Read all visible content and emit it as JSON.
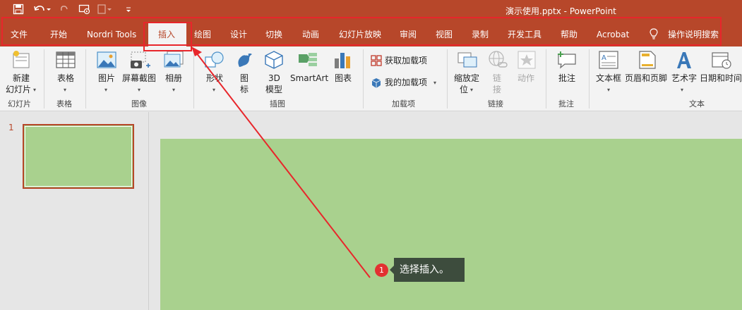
{
  "window": {
    "title": "演示使用.pptx  -  PowerPoint"
  },
  "quick_access": {
    "save_icon": "save-icon",
    "undo_icon": "undo-icon",
    "redo_icon": "redo-icon",
    "present_icon": "start-from-beginning-icon",
    "touch_icon": "touch-mode-icon",
    "customize_icon": "customize-qat-icon"
  },
  "tabs": [
    {
      "label": "文件"
    },
    {
      "label": "开始"
    },
    {
      "label": "Nordri Tools"
    },
    {
      "label": "插入"
    },
    {
      "label": "绘图"
    },
    {
      "label": "设计"
    },
    {
      "label": "切换"
    },
    {
      "label": "动画"
    },
    {
      "label": "幻灯片放映"
    },
    {
      "label": "审阅"
    },
    {
      "label": "视图"
    },
    {
      "label": "录制"
    },
    {
      "label": "开发工具"
    },
    {
      "label": "帮助"
    },
    {
      "label": "Acrobat"
    },
    {
      "label": "操作说明搜索"
    }
  ],
  "active_tab": "插入",
  "ribbon": {
    "new_slide": {
      "line1": "新建",
      "line2": "幻灯片"
    },
    "table": "表格",
    "picture": "图片",
    "screenshot": "屏幕截图",
    "album": "相册",
    "shapes": "形状",
    "icons": {
      "line1": "图",
      "line2": "标"
    },
    "model3d": {
      "line1": "3D",
      "line2": "模型"
    },
    "smartart": "SmartArt",
    "chart": "图表",
    "get_addins": "获取加载项",
    "my_addins": "我的加载项",
    "zoom": {
      "line1": "缩放定",
      "line2": "位"
    },
    "link": {
      "line1": "链",
      "line2": "接"
    },
    "action": "动作",
    "comment": "批注",
    "textbox": "文本框",
    "header_footer": "页眉和页脚",
    "wordart": "艺术字",
    "datetime": "日期和时间",
    "groups": {
      "slides": "幻灯片",
      "tables": "表格",
      "images": "图像",
      "illustrations": "插图",
      "addins": "加载项",
      "links": "链接",
      "comments": "批注",
      "text": "文本"
    }
  },
  "slide_panel": {
    "slide_number": "1"
  },
  "annotation": {
    "step": "1",
    "text": "选择插入。"
  },
  "colors": {
    "accent": "#b7472a",
    "slide_fill": "#a9d18e",
    "highlight": "#e8262b",
    "callout_bg": "#3d4c3d"
  }
}
